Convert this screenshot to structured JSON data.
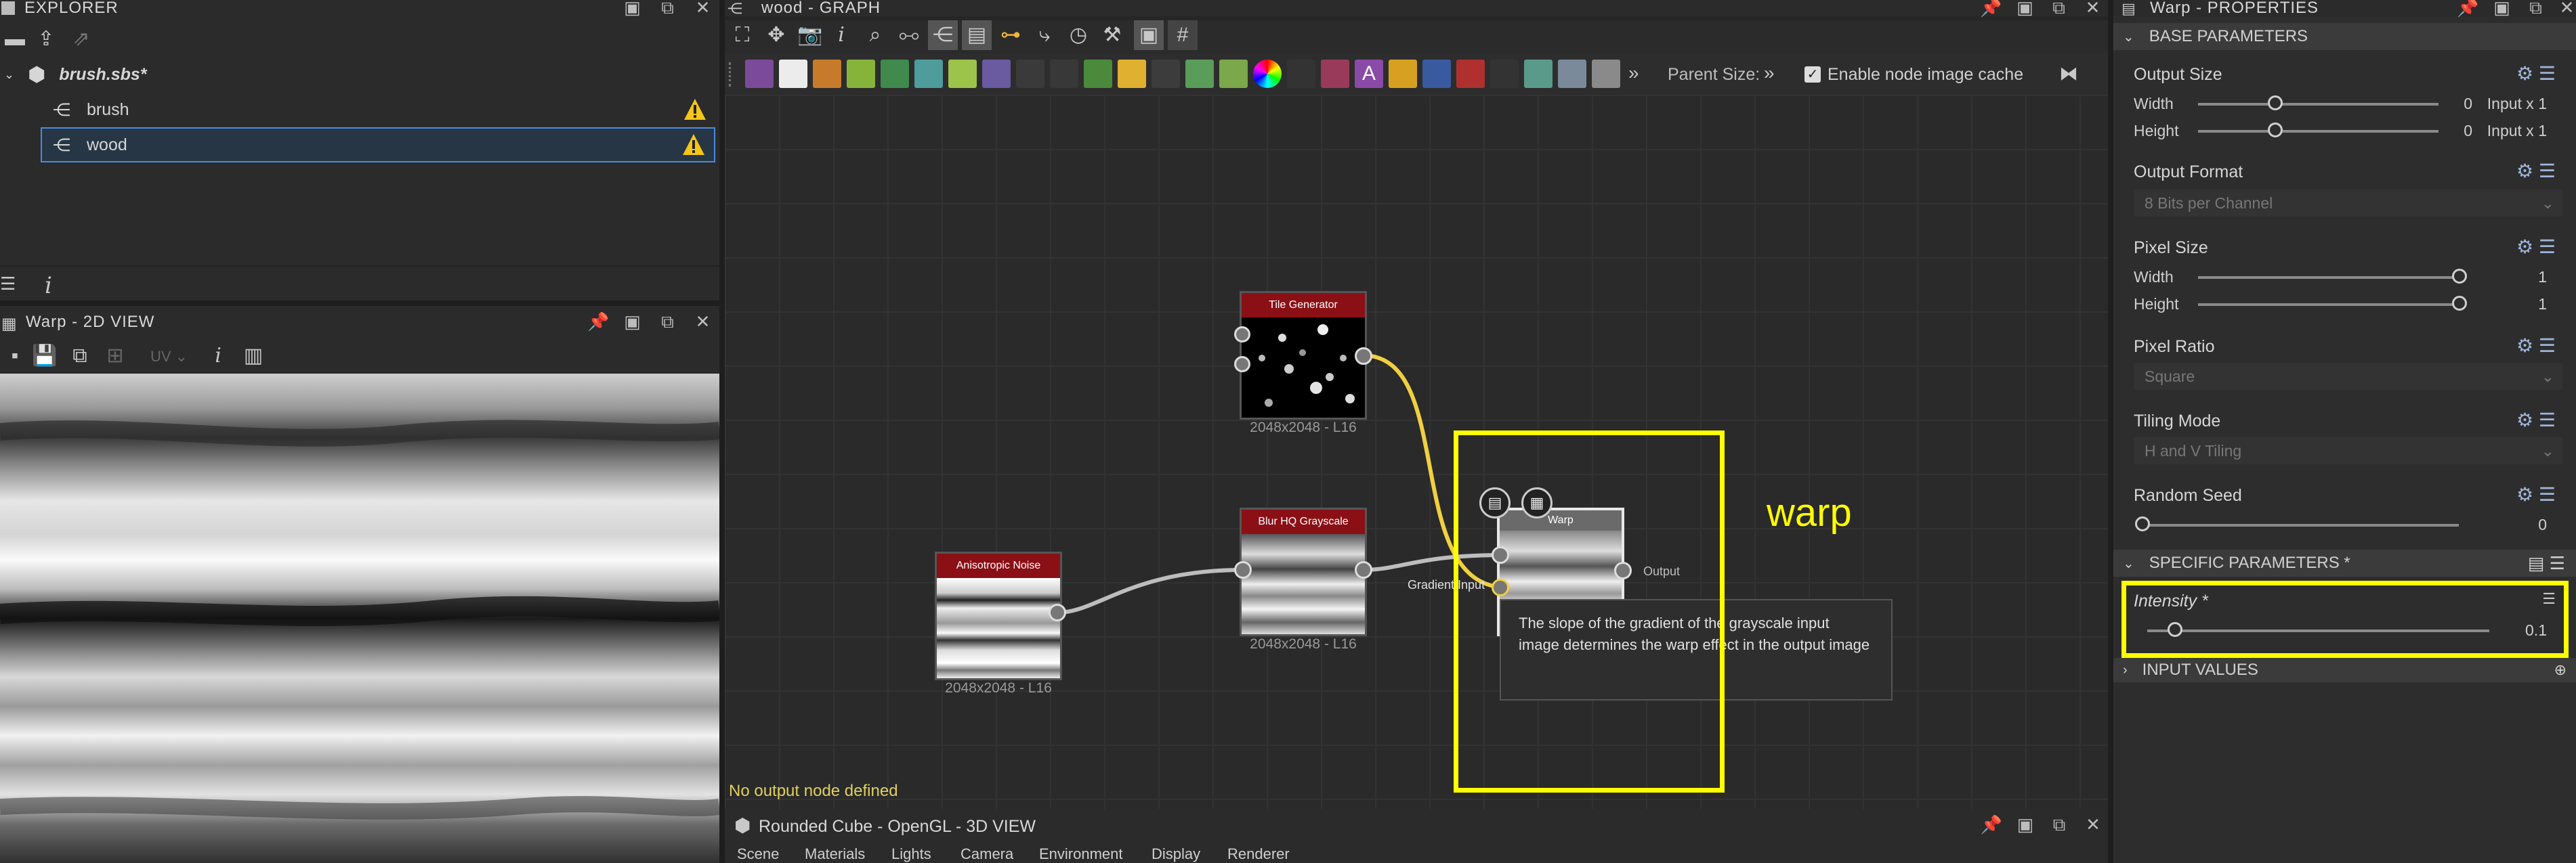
{
  "explorer": {
    "title": "EXPLORER",
    "package": "brush.sbs*",
    "items": [
      {
        "label": "brush"
      },
      {
        "label": "wood"
      }
    ],
    "footer_info": "i"
  },
  "view2d": {
    "title": "Warp - 2D VIEW",
    "uv_label": "UV"
  },
  "graph": {
    "title": "wood - GRAPH",
    "parent_size_label": "Parent Size:",
    "cache_label": "Enable node image cache",
    "status": "No output node defined",
    "nodes": [
      {
        "title": "Tile Generator",
        "footer": "2048x2048 - L16"
      },
      {
        "title": "Blur HQ Grayscale",
        "footer": "2048x2048 - L16"
      },
      {
        "title": "Anisotropic Noise",
        "footer": "2048x2048 - L16"
      },
      {
        "title": "Warp",
        "footer": ""
      }
    ],
    "warp_ports": {
      "gradient_label": "Gradient Input",
      "output_label": "Output"
    },
    "annotation": "warp",
    "tooltip": "The slope of the gradient of the grayscale input image determines the warp effect in the output image"
  },
  "view3d": {
    "title": "Rounded Cube - OpenGL - 3D VIEW",
    "menus": [
      "Scene",
      "Materials",
      "Lights",
      "Camera",
      "Environment",
      "Display",
      "Renderer"
    ]
  },
  "props": {
    "title": "Warp - PROPERTIES",
    "base_header": "BASE PARAMETERS",
    "output_size": {
      "label": "Output Size",
      "width_label": "Width",
      "height_label": "Height",
      "width_value": "0",
      "height_value": "0",
      "width_suffix": "Input x 1",
      "height_suffix": "Input x 1"
    },
    "output_format": {
      "label": "Output Format",
      "value": "8 Bits per Channel"
    },
    "pixel_size": {
      "label": "Pixel Size",
      "width_label": "Width",
      "height_label": "Height",
      "width_value": "1",
      "height_value": "1"
    },
    "pixel_ratio": {
      "label": "Pixel Ratio",
      "value": "Square"
    },
    "tiling_mode": {
      "label": "Tiling Mode",
      "value": "H and V Tiling"
    },
    "random_seed": {
      "label": "Random Seed",
      "value": "0"
    },
    "specific_header": "SPECIFIC PARAMETERS *",
    "intensity": {
      "label": "Intensity *",
      "value": "0.1"
    },
    "input_values_header": "INPUT VALUES"
  },
  "colors": {
    "highlight": "#ffff00",
    "node_header": "#8a1016",
    "accent": "#4a8be0"
  }
}
